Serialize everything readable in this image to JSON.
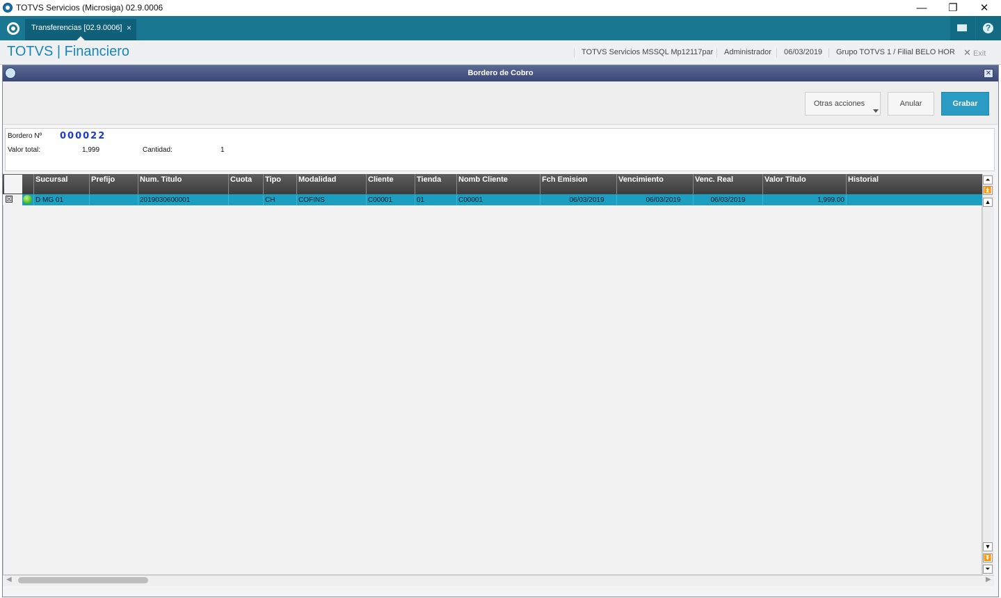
{
  "window": {
    "title": "TOTVS Servicios (Microsiga) 02.9.0006",
    "min": "—",
    "restore": "❐",
    "close": "✕"
  },
  "tab": {
    "label": "Transferencias [02.9.0006]",
    "close": "×"
  },
  "header": {
    "brand": "TOTVS | Financiero",
    "server": "TOTVS Servicios MSSQL Mp12117par",
    "user": "Administrador",
    "date": "06/03/2019",
    "branch": "Grupo TOTVS 1 / Filial BELO HOR",
    "exit": "Exit"
  },
  "dialog": {
    "title": "Bordero de Cobro",
    "buttons": {
      "other": "Otras acciones",
      "cancel": "Anular",
      "save": "Grabar"
    }
  },
  "info": {
    "bordero_label": "Bordero Nº",
    "bordero_value": "000022",
    "total_label": "Valor total:",
    "total_value": "1,999",
    "qty_label": "Cantidad:",
    "qty_value": "1"
  },
  "grid": {
    "columns": [
      "Sucursal",
      "Prefijo",
      "Num. Titulo",
      "Cuota",
      "Tipo",
      "Modalidad",
      "Cliente",
      "Tienda",
      "Nomb Cliente",
      "Fch Emision",
      "Vencimiento",
      "Venc. Real",
      "Valor Titulo",
      "Historial"
    ],
    "rows": [
      {
        "checked": "☒",
        "cells": [
          "D MG 01",
          "",
          "2019030600001",
          "",
          "CH",
          "COFINS",
          "C00001",
          "01",
          "C00001",
          "06/03/2019",
          "06/03/2019",
          "06/03/2019",
          "1,999.00",
          ""
        ]
      }
    ]
  },
  "colors": {
    "accent": "#1a7792",
    "selected_row": "#1c9ec0",
    "primary_button": "#2a9bc3",
    "brand_text": "#1a86b8"
  },
  "icons": {
    "app": "totvs-logo-icon",
    "mail": "mail-icon",
    "help": "help-icon",
    "exit": "close-icon",
    "status": "green-status-icon"
  }
}
